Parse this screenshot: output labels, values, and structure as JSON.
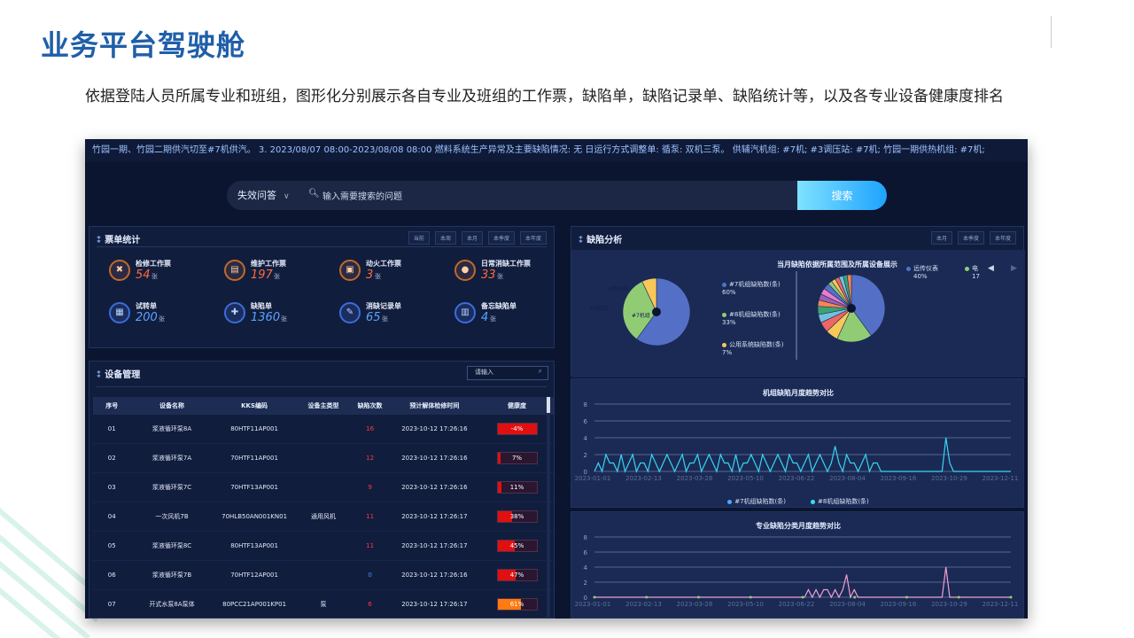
{
  "slide": {
    "title": "业务平台驾驶舱",
    "description": "依据登陆人员所属专业和班组，图形化分别展示各自专业及班组的工作票，缺陷单，缺陷记录单、缺陷统计等，以及各专业设备健康度排名"
  },
  "ticker": "竹园一期、竹园二期供汽切至#7机供汽。 3. 2023/08/07 08:00-2023/08/08 08:00 燃料系统生产异常及主要缺陷情况: 无 日运行方式调整单: 循泵: 双机三泵。 供辅汽机组: #7机; #3调压站: #7机; 竹园一期供热机组: #7机;",
  "search": {
    "dropdown": "失效问答",
    "placeholder": "输入需要搜索的问题",
    "button": "搜索"
  },
  "ticket_panel": {
    "title": "票单统计",
    "tabs": [
      "当前",
      "本周",
      "本月",
      "本季度",
      "本年度"
    ],
    "stats": [
      {
        "label": "检修工作票",
        "value": "54",
        "unit": "张",
        "icon": "wrench-icon",
        "glyph": "✖",
        "style": "orange"
      },
      {
        "label": "维护工作票",
        "value": "197",
        "unit": "张",
        "icon": "ticket-icon",
        "glyph": "▤",
        "style": "orange"
      },
      {
        "label": "动火工作票",
        "value": "3",
        "unit": "张",
        "icon": "fire-icon",
        "glyph": "▣",
        "style": "orange"
      },
      {
        "label": "日常消缺工作票",
        "value": "33",
        "unit": "张",
        "icon": "location-icon",
        "glyph": "●",
        "style": "orange"
      },
      {
        "label": "试转单",
        "value": "200",
        "unit": "张",
        "icon": "test-icon",
        "glyph": "▦",
        "style": "blue"
      },
      {
        "label": "缺陷单",
        "value": "1360",
        "unit": "张",
        "icon": "puzzle-icon",
        "glyph": "✚",
        "style": "blue"
      },
      {
        "label": "消缺记录单",
        "value": "65",
        "unit": "张",
        "icon": "edit-icon",
        "glyph": "✎",
        "style": "blue"
      },
      {
        "label": "备忘缺陷单",
        "value": "4",
        "unit": "张",
        "icon": "memo-icon",
        "glyph": "▥",
        "style": "blue"
      }
    ]
  },
  "equipment_panel": {
    "title": "设备管理",
    "search_placeholder": "请输入",
    "columns": [
      "序号",
      "设备名称",
      "KKS编码",
      "设备主类型",
      "缺陷次数",
      "预计解体检修时间",
      "健康度"
    ],
    "rows": [
      {
        "no": "01",
        "name": "浆液循环泵8A",
        "kks": "80HTF11AP001",
        "type": "",
        "count": "16",
        "time": "2023-10-12 17:26:16",
        "health": "-4%",
        "pct": 100,
        "color": "#e01010"
      },
      {
        "no": "02",
        "name": "浆液循环泵7A",
        "kks": "70HTF11AP001",
        "type": "",
        "count": "12",
        "time": "2023-10-12 17:26:16",
        "health": "7%",
        "pct": 7,
        "color": "#e01010"
      },
      {
        "no": "03",
        "name": "浆液循环泵7C",
        "kks": "70HTF13AP001",
        "type": "",
        "count": "9",
        "time": "2023-10-12 17:26:16",
        "health": "11%",
        "pct": 11,
        "color": "#e01010"
      },
      {
        "no": "04",
        "name": "一次风机7B",
        "kks": "70HLB50AN001KN01",
        "type": "通用风机",
        "count": "11",
        "time": "2023-10-12 17:26:17",
        "health": "38%",
        "pct": 38,
        "color": "#e01010"
      },
      {
        "no": "05",
        "name": "浆液循环泵8C",
        "kks": "80HTF13AP001",
        "type": "",
        "count": "11",
        "time": "2023-10-12 17:26:17",
        "health": "45%",
        "pct": 45,
        "color": "#e01010"
      },
      {
        "no": "06",
        "name": "浆液循环泵7B",
        "kks": "70HTF12AP001",
        "type": "",
        "count": "0",
        "time": "2023-10-12 17:26:16",
        "health": "47%",
        "pct": 47,
        "color": "#e01010"
      },
      {
        "no": "07",
        "name": "开式水泵8A泵体",
        "kks": "80PCC21AP001KP01",
        "type": "泵",
        "count": "6",
        "time": "2023-10-12 17:26:17",
        "health": "61%",
        "pct": 61,
        "color": "#ff7a10"
      }
    ]
  },
  "defect_panel": {
    "title": "缺陷分析",
    "tabs": [
      "本月",
      "本季度",
      "本年度"
    ],
    "pie_title": "当月缺陷依据所属范围及所属设备展示",
    "pie1_labels": [
      "公用系统",
      "#8机组",
      "#7机组"
    ],
    "pie1_legend": [
      {
        "name": "#7机组缺陷数(条)",
        "pct": "60%",
        "color": "#5470c6"
      },
      {
        "name": "#8机组缺陷数(条)",
        "pct": "33%",
        "color": "#91cc75"
      },
      {
        "name": "公用系统缺陷数(条)",
        "pct": "7%",
        "color": "#fac858"
      }
    ],
    "pie2_legend": [
      {
        "name": "远传仪表",
        "pct": "40%",
        "color": "#5470c6"
      },
      {
        "name": "电",
        "pct": "17",
        "color": "#91cc75"
      }
    ]
  },
  "chart_data": [
    {
      "type": "pie",
      "title": "当月缺陷依据所属范围及所属设备展示",
      "categories": [
        "#7机组缺陷数(条)",
        "#8机组缺陷数(条)",
        "公用系统缺陷数(条)"
      ],
      "values": [
        60,
        33,
        7
      ]
    },
    {
      "type": "line",
      "title": "机组缺陷月度趋势对比",
      "x": [
        "2023-01-01",
        "2023-02-13",
        "2023-03-28",
        "2023-05-10",
        "2023-06-22",
        "2023-08-04",
        "2023-09-16",
        "2023-10-29",
        "2023-12-11"
      ],
      "ylim": [
        0,
        8
      ],
      "yticks": [
        0,
        2,
        4,
        6,
        8
      ],
      "series": [
        {
          "name": "#7机组缺陷数(条)",
          "color": "#4ea6ff"
        },
        {
          "name": "#8机组缺陷数(条)",
          "color": "#37e0f0"
        }
      ],
      "values": [
        0,
        1,
        0,
        2,
        1,
        1,
        0,
        2,
        0,
        1,
        2,
        0,
        1,
        1,
        0,
        2,
        1,
        0,
        1,
        2,
        1,
        0,
        1,
        2,
        0,
        1,
        1,
        2,
        0,
        1,
        2,
        1,
        0,
        2,
        1,
        1,
        0,
        2,
        0,
        1,
        1,
        2,
        1,
        0,
        2,
        1,
        0,
        1,
        2,
        1,
        0,
        2,
        1,
        1,
        0,
        1,
        2,
        0,
        1,
        2,
        1,
        0,
        1,
        3,
        1,
        0,
        2,
        1,
        1,
        0,
        1,
        2,
        0,
        1,
        1,
        0,
        0,
        0,
        0,
        0,
        0,
        0,
        0,
        0,
        0,
        0,
        0,
        0,
        0,
        0,
        0,
        0,
        4,
        1,
        0,
        0,
        0,
        0,
        0,
        0,
        0,
        0,
        0,
        0,
        0,
        0,
        0,
        0,
        0,
        0
      ]
    },
    {
      "type": "line",
      "title": "专业缺陷分类月度趋势对比",
      "x": [
        "2023-01-01",
        "2023-02-13",
        "2023-03-28",
        "2023-05-10",
        "2023-06-22",
        "2023-08-04",
        "2023-09-16",
        "2023-10-29",
        "2023-12-11"
      ],
      "ylim": [
        0,
        8
      ],
      "yticks": [
        0,
        2,
        4,
        6,
        8
      ],
      "values": [
        0,
        0,
        0,
        0,
        0,
        0,
        0,
        0,
        0,
        0,
        0,
        0,
        0,
        0,
        0,
        0,
        0,
        0,
        0,
        0,
        0,
        0,
        0,
        0,
        0,
        0,
        0,
        0,
        0,
        0,
        0,
        0,
        0,
        0,
        0,
        0,
        0,
        0,
        0,
        0,
        0,
        0,
        0,
        0,
        0,
        0,
        0,
        0,
        0,
        0,
        0,
        0,
        0,
        0,
        0,
        0,
        1,
        0,
        1,
        0,
        1,
        1,
        0,
        1,
        0,
        1,
        3,
        0,
        1,
        0,
        0,
        0,
        0,
        0,
        0,
        0,
        0,
        0,
        0,
        0,
        0,
        0,
        0,
        0,
        0,
        0,
        0,
        0,
        0,
        0,
        0,
        0,
        4,
        0,
        0,
        0,
        0,
        0,
        0,
        0,
        0,
        0,
        0,
        0,
        0,
        0,
        0,
        0,
        0,
        0
      ]
    }
  ],
  "trend1": {
    "title": "机组缺陷月度趋势对比"
  },
  "trend2": {
    "title": "专业缺陷分类月度趋势对比"
  }
}
